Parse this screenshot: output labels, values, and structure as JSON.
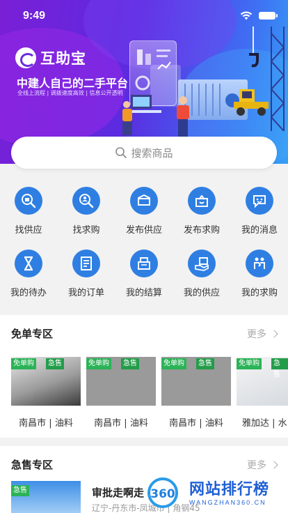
{
  "status": {
    "time": "9:49"
  },
  "banner": {
    "brand_name": "互助宝",
    "slogan": "中建人自己的二手平台",
    "features": "全线上流程 | 调拨速度高效 | 信息公开透明"
  },
  "search": {
    "placeholder": "搜索商品"
  },
  "quick_actions": [
    {
      "label": "找供应",
      "icon": "find-supply-icon"
    },
    {
      "label": "找求购",
      "icon": "find-demand-icon"
    },
    {
      "label": "发布供应",
      "icon": "publish-supply-icon"
    },
    {
      "label": "发布求购",
      "icon": "publish-demand-icon"
    },
    {
      "label": "我的消息",
      "icon": "message-icon"
    },
    {
      "label": "我的待办",
      "icon": "hourglass-icon"
    },
    {
      "label": "我的订单",
      "icon": "order-icon"
    },
    {
      "label": "我的结算",
      "icon": "cash-register-icon"
    },
    {
      "label": "我的供应",
      "icon": "supply-box-icon"
    },
    {
      "label": "我的求购",
      "icon": "handshake-icon"
    }
  ],
  "free_section": {
    "title": "免单专区",
    "more": "更多",
    "cards": [
      {
        "tag1": "免单购",
        "tag2": "急售",
        "caption": "南昌市 | 油料"
      },
      {
        "tag1": "免单购",
        "tag2": "急售",
        "caption": "南昌市 | 油料"
      },
      {
        "tag1": "免单购",
        "tag2": "急售",
        "caption": "南昌市 | 油料"
      },
      {
        "tag1": "免单购",
        "tag2": "急售",
        "caption": "雅加达 | 水"
      }
    ]
  },
  "urgent_section": {
    "title": "急售专区",
    "more": "更多",
    "items": [
      {
        "tag": "急售",
        "title": "审批走啊走",
        "subtitle": "辽宁-丹东市-凤城市 | 角钢45"
      }
    ]
  },
  "watermark": {
    "text": "网站排行榜",
    "sub": "WANGZHAN360.CN"
  },
  "colors": {
    "accent": "#2f7fe3",
    "tag_green": "#2bb357",
    "banner_start": "#7a1fd6",
    "banner_end": "#35a0f5"
  }
}
